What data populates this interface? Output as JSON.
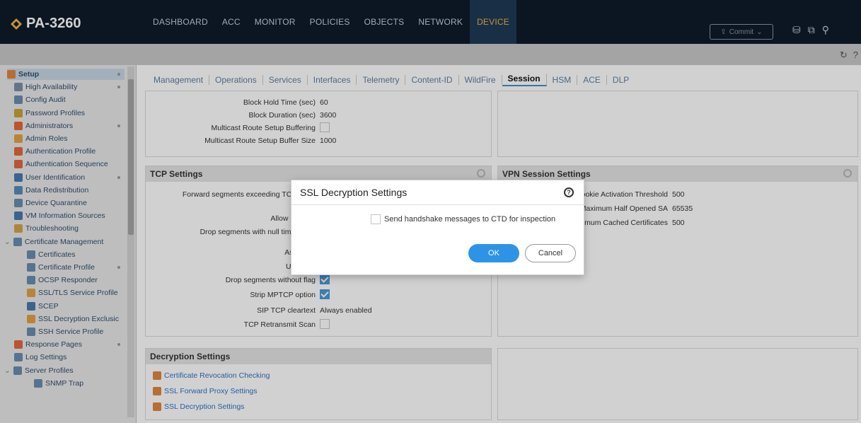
{
  "app": {
    "title": "PA-3260",
    "brand_color": "#f3b24a"
  },
  "nav": {
    "tabs": [
      "DASHBOARD",
      "ACC",
      "MONITOR",
      "POLICIES",
      "OBJECTS",
      "NETWORK",
      "DEVICE"
    ],
    "active": "DEVICE",
    "commit_label": "Commit"
  },
  "sidebar": {
    "items": [
      {
        "label": "Setup",
        "icon": "setup-icon"
      },
      {
        "label": "High Availability",
        "icon": "ha-icon"
      },
      {
        "label": "Config Audit",
        "icon": "audit-icon"
      },
      {
        "label": "Password Profiles",
        "icon": "password-icon"
      },
      {
        "label": "Administrators",
        "icon": "admin-icon"
      },
      {
        "label": "Admin Roles",
        "icon": "roles-icon"
      },
      {
        "label": "Authentication Profile",
        "icon": "auth-icon"
      },
      {
        "label": "Authentication Sequence",
        "icon": "auth-seq-icon"
      },
      {
        "label": "User Identification",
        "icon": "user-id-icon"
      },
      {
        "label": "Data Redistribution",
        "icon": "redistribution-icon"
      },
      {
        "label": "Device Quarantine",
        "icon": "quarantine-icon"
      },
      {
        "label": "VM Information Sources",
        "icon": "vm-icon"
      },
      {
        "label": "Troubleshooting",
        "icon": "troubleshoot-icon"
      },
      {
        "label": "Certificate Management",
        "icon": "cert-mgmt-icon"
      },
      {
        "label": "Certificates",
        "icon": "cert-icon"
      },
      {
        "label": "Certificate Profile",
        "icon": "cert-profile-icon"
      },
      {
        "label": "OCSP Responder",
        "icon": "ocsp-icon"
      },
      {
        "label": "SSL/TLS Service Profile",
        "icon": "lock-icon"
      },
      {
        "label": "SCEP",
        "icon": "scep-icon"
      },
      {
        "label": "SSL Decryption Exclusic",
        "icon": "lock-icon"
      },
      {
        "label": "SSH Service Profile",
        "icon": "ssh-icon"
      },
      {
        "label": "Response Pages",
        "icon": "response-icon"
      },
      {
        "label": "Log Settings",
        "icon": "log-icon"
      },
      {
        "label": "Server Profiles",
        "icon": "server-icon"
      },
      {
        "label": "SNMP Trap",
        "icon": "snmp-icon"
      }
    ]
  },
  "tabs": {
    "items": [
      "Management",
      "Operations",
      "Services",
      "Interfaces",
      "Telemetry",
      "Content-ID",
      "WildFire",
      "Session",
      "HSM",
      "ACE",
      "DLP"
    ],
    "active": "Session"
  },
  "session_top": {
    "rows": [
      {
        "label": "Block Hold Time (sec)",
        "value": "60"
      },
      {
        "label": "Block Duration (sec)",
        "value": "3600"
      },
      {
        "label": "Multicast Route Setup Buffering",
        "value": ""
      },
      {
        "label": "Multicast Route Setup Buffer Size",
        "value": "1000"
      }
    ]
  },
  "tcp": {
    "title": "TCP Settings",
    "rows": [
      {
        "label": "Forward segments exceeding TCP out-o",
        "value": ""
      },
      {
        "label": "Allow Challen",
        "value": ""
      },
      {
        "label": "Drop segments with null timestamp",
        "value": ""
      },
      {
        "label": "Asymmet",
        "value": ""
      },
      {
        "label": "Urgent D",
        "value": ""
      },
      {
        "label": "Drop segments without flag",
        "value": ""
      },
      {
        "label": "Strip MPTCP option",
        "value": ""
      },
      {
        "label": "SIP TCP cleartext",
        "value": "Always enabled"
      },
      {
        "label": "TCP Retransmit Scan",
        "value": ""
      }
    ]
  },
  "vpn": {
    "title": "VPN Session Settings",
    "rows": [
      {
        "label": "ookie Activation Threshold",
        "value": "500"
      },
      {
        "label": "Maximum Half Opened SA",
        "value": "65535"
      },
      {
        "label": "ximum Cached Certificates",
        "value": "500"
      }
    ]
  },
  "decryption": {
    "title": "Decryption Settings",
    "links": [
      "Certificate Revocation Checking",
      "SSL Forward Proxy Settings",
      "SSL Decryption Settings"
    ]
  },
  "modal": {
    "title": "SSL Decryption Settings",
    "help_symbol": "?",
    "checkbox_label": "Send handshake messages to CTD for inspection",
    "ok_label": "OK",
    "cancel_label": "Cancel"
  }
}
